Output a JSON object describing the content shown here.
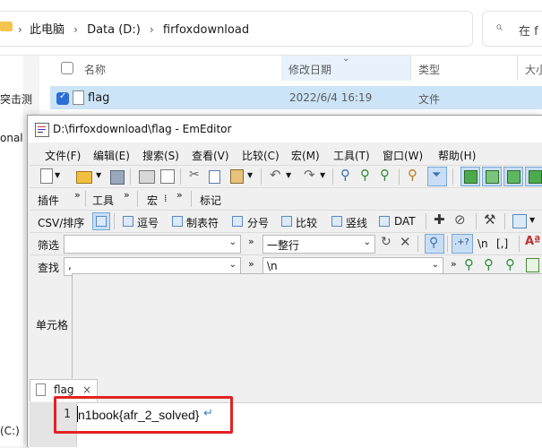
{
  "explorer": {
    "breadcrumbs": [
      "此电脑",
      "Data (D:)",
      "firfoxdownload"
    ],
    "search_placeholder": "在 f",
    "columns": [
      "名称",
      "修改日期",
      "类型",
      "大小"
    ],
    "rows": [
      {
        "name": "flag",
        "modified": "2022/6/4 16:19",
        "type": "文件"
      }
    ],
    "left_fragments": [
      "突击测",
      "onal",
      "(C:)"
    ]
  },
  "emeditor": {
    "title": "D:\\firfoxdownload\\flag - EmEditor",
    "menu": [
      "文件(F)",
      "编辑(E)",
      "搜索(S)",
      "查看(V)",
      "比较(C)",
      "宏(M)",
      "工具(T)",
      "窗口(W)",
      "帮助(H)"
    ],
    "toolbar_groups": [
      "插件",
      "工具",
      "宏",
      "标记"
    ],
    "csv": {
      "label": "CSV/排序",
      "items": [
        "逗号",
        "制表符",
        "分号",
        "比较",
        "竖线",
        "DAT"
      ]
    },
    "filter": {
      "label": "筛选",
      "mode": "一整行",
      "regex_label": ".+?",
      "newline_label": "\\n",
      "bracket_label": "[,]"
    },
    "find": {
      "label": "查找",
      "value": ",",
      "replace_value": "\\n"
    },
    "cell_label": "单元格",
    "tab": {
      "name": "flag",
      "close": "×"
    },
    "editor": {
      "line_number": "1",
      "line_text": "n1book{afr_2_solved}"
    },
    "colors": {
      "accent": "#2a6fd6",
      "highlight_box": "#e32222",
      "selection": "#cce4f7"
    }
  }
}
